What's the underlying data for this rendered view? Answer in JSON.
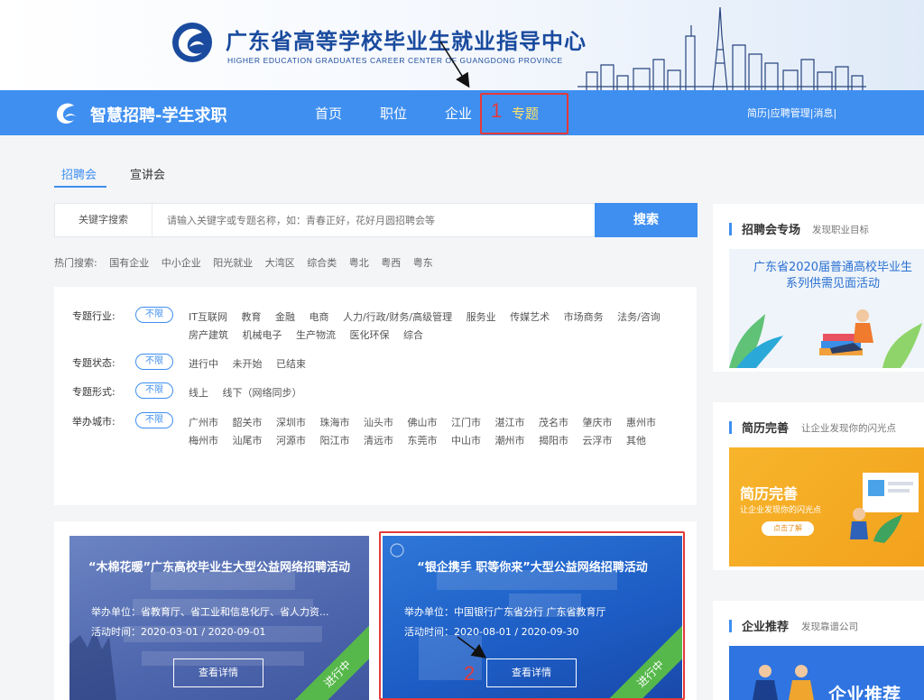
{
  "banner": {
    "title": "广东省高等学校毕业生就业指导中心",
    "subtitle": "HIGHER EDUCATION GRADUATES CAREER CENTER OF GUANGDONG PROVINCE"
  },
  "nav": {
    "brand": "智慧招聘-学生求职",
    "links": [
      "首页",
      "职位",
      "企业",
      "专题"
    ],
    "active": "专题",
    "right": [
      "简历",
      "应聘管理",
      "消息"
    ]
  },
  "annotations": {
    "step1": "1",
    "step2": "2",
    "color": "#e53a3a"
  },
  "tabs": [
    "招聘会",
    "宣讲会"
  ],
  "search": {
    "label": "关键字搜索",
    "placeholder": "请输入关键字或专题名称，如：青春正好，花好月圆招聘会等",
    "button": "搜索"
  },
  "hot_search": {
    "label": "热门搜索:",
    "items": [
      "国有企业",
      "中小企业",
      "阳光就业",
      "大湾区",
      "综合类",
      "粤北",
      "粤西",
      "粤东"
    ]
  },
  "filters": {
    "all_label": "不限",
    "rows": [
      {
        "label": "专题行业:",
        "options": [
          "IT互联网",
          "教育",
          "金融",
          "电商",
          "人力/行政/财务/高级管理",
          "服务业",
          "传媒艺术",
          "市场商务",
          "法务/咨询",
          "房产建筑",
          "机械电子",
          "生产物流",
          "医化环保",
          "综合"
        ]
      },
      {
        "label": "专题状态:",
        "options": [
          "进行中",
          "未开始",
          "已结束"
        ]
      },
      {
        "label": "专题形式:",
        "options": [
          "线上",
          "线下（网络同步）"
        ]
      },
      {
        "label": "举办城市:",
        "options": [
          "广州市",
          "韶关市",
          "深圳市",
          "珠海市",
          "汕头市",
          "佛山市",
          "江门市",
          "湛江市",
          "茂名市",
          "肇庆市",
          "惠州市",
          "梅州市",
          "汕尾市",
          "河源市",
          "阳江市",
          "清远市",
          "东莞市",
          "中山市",
          "潮州市",
          "揭阳市",
          "云浮市",
          "其他"
        ]
      }
    ]
  },
  "cards": [
    {
      "title": "“木棉花暖”广东高校毕业生大型公益网络招聘活动",
      "organizer": "举办单位：省教育厅、省工业和信息化厅、省人力资...",
      "time": "活动时间：2020-03-01 / 2020-09-01",
      "button": "查看详情",
      "status": "进行中"
    },
    {
      "title": "“银企携手 职等你来”大型公益网络招聘活动",
      "organizer": "举办单位：中国银行广东省分行 广东省教育厅",
      "time": "活动时间：2020-08-01 / 2020-09-30",
      "button": "查看详情",
      "status": "进行中"
    }
  ],
  "sidebar": [
    {
      "title": "招聘会专场",
      "subtitle": "发现职业目标",
      "image_caption": "广东省2020届普通高校毕业生\n系列供需见面活动"
    },
    {
      "title": "简历完善",
      "subtitle": "让企业发现你的闪光点",
      "image_title": "简历完善",
      "image_sub": "让企业发现你的闪光点",
      "image_btn": "点击了解"
    },
    {
      "title": "企业推荐",
      "subtitle": "发现靠谱公司",
      "image_title": "企业推荐"
    }
  ],
  "colors": {
    "primary": "#3f8ff0",
    "accent_yellow": "#ffe36b",
    "ribbon_green": "#56b84a",
    "banner_text": "#1a4b9e"
  }
}
